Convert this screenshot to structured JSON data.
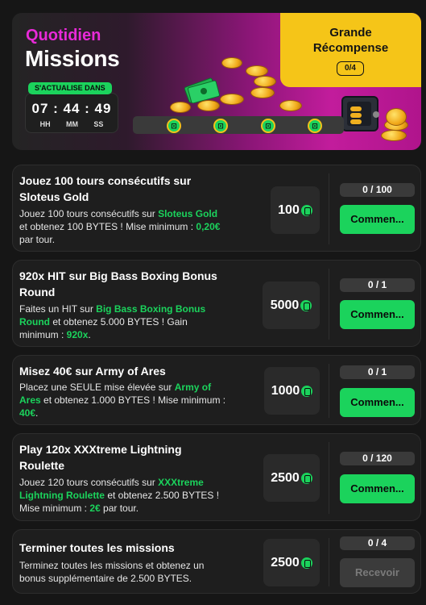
{
  "hero": {
    "title_line1": "Quotidien",
    "title_line2": "Missions",
    "refresh_label": "S'ACTUALISE DANS",
    "timer": {
      "display": "07 : 44 : 49",
      "units": [
        "HH",
        "MM",
        "SS"
      ]
    },
    "grand_reward": {
      "title": "Grande Récompense",
      "progress": "0/4"
    },
    "milestones_completed": 0,
    "milestones_total": 4
  },
  "colors": {
    "accent": "#1bd35c",
    "magenta": "#e82ad8",
    "gold": "#f5c518",
    "card": "#1e1e1e"
  },
  "currency_icon": "bytes-coin-icon",
  "missions": [
    {
      "title": "Jouez 100 tours consécutifs sur Sloteus Gold",
      "desc": [
        {
          "t": "Jouez 100 tours consécutifs sur "
        },
        {
          "t": "Sloteus Gold",
          "hl": true
        },
        {
          "t": " et obtenez 100 BYTES ! Mise minimum : "
        },
        {
          "t": "0,20€",
          "hl": true
        },
        {
          "t": " par tour."
        }
      ],
      "reward": "100",
      "progress": "0 / 100",
      "button": "Commen...",
      "button_enabled": true
    },
    {
      "title": "920x HIT sur Big Bass Boxing Bonus Round",
      "desc": [
        {
          "t": "Faites un HIT sur "
        },
        {
          "t": "Big Bass Boxing Bonus Round",
          "hl": true
        },
        {
          "t": " et obtenez 5.000 BYTES ! Gain minimum : "
        },
        {
          "t": "920x",
          "hl": true
        },
        {
          "t": "."
        }
      ],
      "reward": "5000",
      "progress": "0 / 1",
      "button": "Commen...",
      "button_enabled": true
    },
    {
      "title": "Misez 40€ sur Army of Ares",
      "desc": [
        {
          "t": "Placez une SEULE mise élevée sur "
        },
        {
          "t": "Army of Ares",
          "hl": true
        },
        {
          "t": " et obtenez 1.000 BYTES ! Mise minimum : "
        },
        {
          "t": "40€",
          "hl": true
        },
        {
          "t": "."
        }
      ],
      "reward": "1000",
      "progress": "0 / 1",
      "button": "Commen...",
      "button_enabled": true
    },
    {
      "title": "Play 120x XXXtreme Lightning Roulette",
      "desc": [
        {
          "t": "Jouez 120 tours consécutifs sur "
        },
        {
          "t": "XXXtreme Lightning Roulette",
          "hl": true
        },
        {
          "t": " et obtenez 2.500 BYTES ! Mise minimum : "
        },
        {
          "t": "2€",
          "hl": true
        },
        {
          "t": " par tour."
        }
      ],
      "reward": "2500",
      "progress": "0 / 120",
      "button": "Commen...",
      "button_enabled": true
    },
    {
      "title": "Terminer toutes les missions",
      "desc": [
        {
          "t": "Terminez toutes les missions et obtenez un bonus supplémentaire de 2.500 BYTES."
        }
      ],
      "reward": "2500",
      "progress": "0 / 4",
      "button": "Recevoir",
      "button_enabled": false
    }
  ]
}
